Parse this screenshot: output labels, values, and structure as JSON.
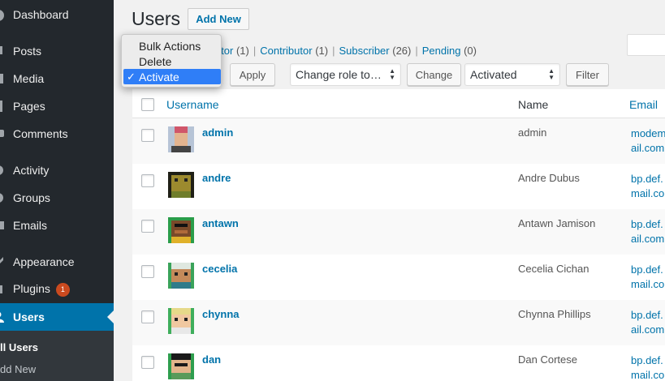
{
  "sidebar": {
    "items": [
      {
        "label": "Dashboard",
        "icon": "dashboard-icon"
      },
      {
        "label": "Posts",
        "icon": "pin-icon"
      },
      {
        "label": "Media",
        "icon": "media-icon"
      },
      {
        "label": "Pages",
        "icon": "pages-icon"
      },
      {
        "label": "Comments",
        "icon": "comment-icon"
      },
      {
        "label": "Activity",
        "icon": "activity-icon"
      },
      {
        "label": "Groups",
        "icon": "groups-icon"
      },
      {
        "label": "Emails",
        "icon": "email-icon"
      },
      {
        "label": "Appearance",
        "icon": "brush-icon"
      },
      {
        "label": "Plugins",
        "icon": "plugin-icon",
        "badge": "1"
      },
      {
        "label": "Users",
        "icon": "users-icon",
        "active": true
      }
    ],
    "submenu": {
      "current": "ll Users",
      "other": "dd New"
    }
  },
  "header": {
    "title": "Users",
    "add_new": "Add New"
  },
  "filters": {
    "administrator_partial": "trator",
    "administrator_count": "(1)",
    "contributor": "Contributor",
    "contributor_count": "(1)",
    "subscriber": "Subscriber",
    "subscriber_count": "(26)",
    "pending": "Pending",
    "pending_count": "(0)"
  },
  "toolbar": {
    "apply": "Apply",
    "change_role": "Change role to…",
    "change": "Change",
    "status_select": "Activated",
    "filter": "Filter"
  },
  "bulk_dropdown": {
    "options": [
      "Bulk Actions",
      "Delete",
      "Activate"
    ],
    "selected": "Activate",
    "check": "✓"
  },
  "table": {
    "columns": {
      "username": "Username",
      "name": "Name",
      "email": "Email"
    },
    "rows": [
      {
        "username": "admin",
        "name": "admin",
        "email": [
          "modem",
          "ail.com"
        ]
      },
      {
        "username": "andre",
        "name": "Andre Dubus",
        "email": [
          "bp.def.",
          "mail.co"
        ]
      },
      {
        "username": "antawn",
        "name": "Antawn Jamison",
        "email": [
          "bp.def.",
          "ail.com"
        ]
      },
      {
        "username": "cecelia",
        "name": "Cecelia Cichan",
        "email": [
          "bp.def.",
          "mail.co"
        ]
      },
      {
        "username": "chynna",
        "name": "Chynna Phillips",
        "email": [
          "bp.def.",
          "ail.com"
        ]
      },
      {
        "username": "dan",
        "name": "Dan Cortese",
        "email": [
          "bp.def.",
          "mail.co"
        ]
      }
    ]
  },
  "colors": {
    "sidebar_bg": "#23282d",
    "active_bg": "#0073aa",
    "link": "#0073aa",
    "badge": "#ca4a1f",
    "select_highlight": "#2f7ef7"
  }
}
